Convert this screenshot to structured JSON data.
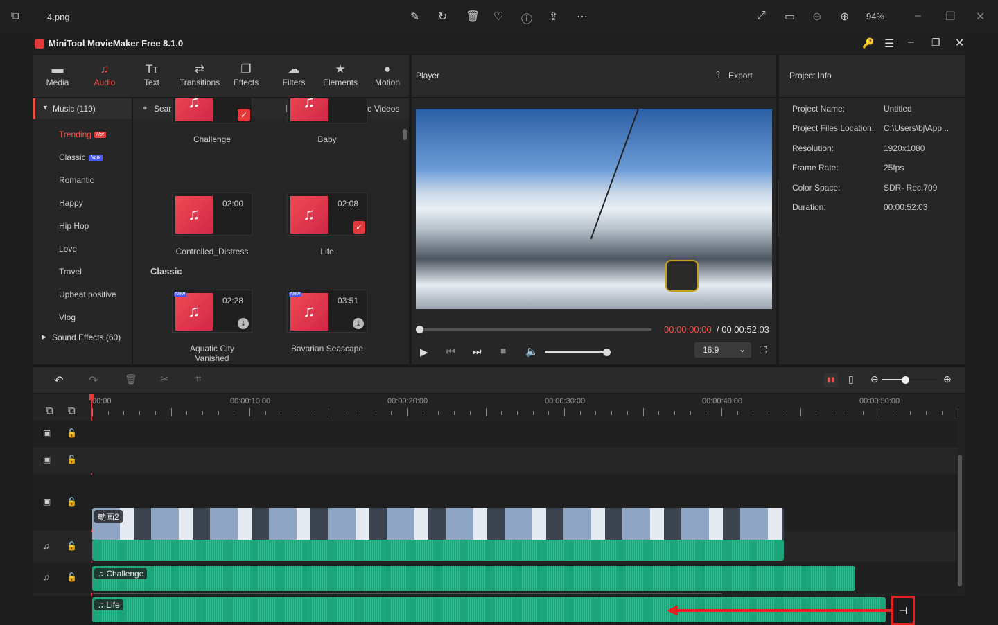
{
  "viewer": {
    "file_name": "4.png",
    "zoom": "94%"
  },
  "app": {
    "title": "MiniTool MovieMaker Free 8.1.0"
  },
  "toolbar": [
    {
      "label": "Media",
      "icon": "folder-icon"
    },
    {
      "label": "Audio",
      "icon": "music-note-icon",
      "active": true
    },
    {
      "label": "Text",
      "icon": "text-icon"
    },
    {
      "label": "Transitions",
      "icon": "transitions-icon"
    },
    {
      "label": "Effects",
      "icon": "effects-icon"
    },
    {
      "label": "Filters",
      "icon": "filters-icon"
    },
    {
      "label": "Elements",
      "icon": "elements-icon"
    },
    {
      "label": "Motion",
      "icon": "motion-icon"
    }
  ],
  "library": {
    "music_group": "Music (119)",
    "categories": [
      "Trending",
      "Classic",
      "Romantic",
      "Happy",
      "Hip Hop",
      "Love",
      "Travel",
      "Upbeat positive",
      "Vlog"
    ],
    "trending_badge": "Hot",
    "classic_badge": "New",
    "sound_effects": "Sound Effects (60)",
    "search_placeholder": "Search audio",
    "download_youtube": "Download YouTube Videos",
    "section_classic": "Classic",
    "items": [
      {
        "title": "Challenge",
        "duration": "",
        "added": true
      },
      {
        "title": "Baby",
        "duration": "",
        "added": false
      },
      {
        "title": "Controlled_Distress",
        "duration": "02:00",
        "added": false
      },
      {
        "title": "Life",
        "duration": "02:08",
        "added": true
      },
      {
        "title": "Aquatic City Vanished",
        "duration": "02:28",
        "new": "New"
      },
      {
        "title": "Bavarian Seascape",
        "duration": "03:51",
        "new": "New"
      }
    ]
  },
  "player": {
    "title": "Player",
    "export": "Export",
    "current_time": "00:00:00:00",
    "total_time": "/ 00:00:52:03",
    "aspect": "16:9",
    "volume": 0.8,
    "progress": 0
  },
  "project_info": {
    "title": "Project Info",
    "rows": [
      {
        "label": "Project Name:",
        "value": "Untitled"
      },
      {
        "label": "Project Files Location:",
        "value": "C:\\Users\\bj\\App..."
      },
      {
        "label": "Resolution:",
        "value": "1920x1080"
      },
      {
        "label": "Frame Rate:",
        "value": "25fps"
      },
      {
        "label": "Color Space:",
        "value": "SDR- Rec.709"
      },
      {
        "label": "Duration:",
        "value": "00:00:52:03"
      }
    ]
  },
  "timeline": {
    "ruler": [
      "00:00",
      "00:00:10:00",
      "00:00:20:00",
      "00:00:30:00",
      "00:00:40:00",
      "00:00:50:00"
    ],
    "zoom": 0.45,
    "video_clip": "動画2",
    "audio_clips": [
      "Challenge",
      "Life"
    ],
    "colors": {
      "accent": "#f0504a",
      "wave": "#22b384",
      "arrow": "#e82020"
    }
  }
}
